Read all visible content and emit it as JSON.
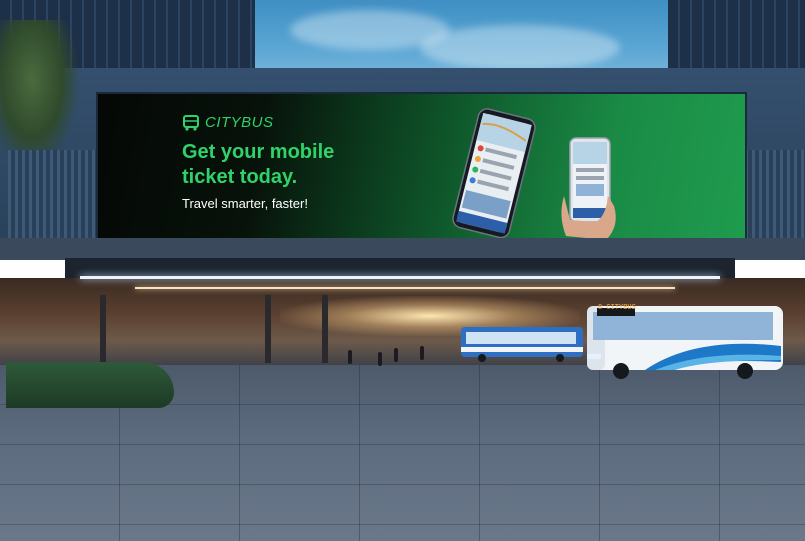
{
  "billboard": {
    "brand": "CITYBUS",
    "headline_line1": "Get your mobile",
    "headline_line2": "ticket today.",
    "tagline": "Travel smarter, faster!"
  },
  "bus_display": "8 CITYBUS",
  "colors": {
    "brand_green": "#2fd36a",
    "billboard_dark": "#050806",
    "sky": "#4f9ccd",
    "facade": "#2f4864"
  },
  "icons": {
    "brand_logo": "bus-icon"
  }
}
